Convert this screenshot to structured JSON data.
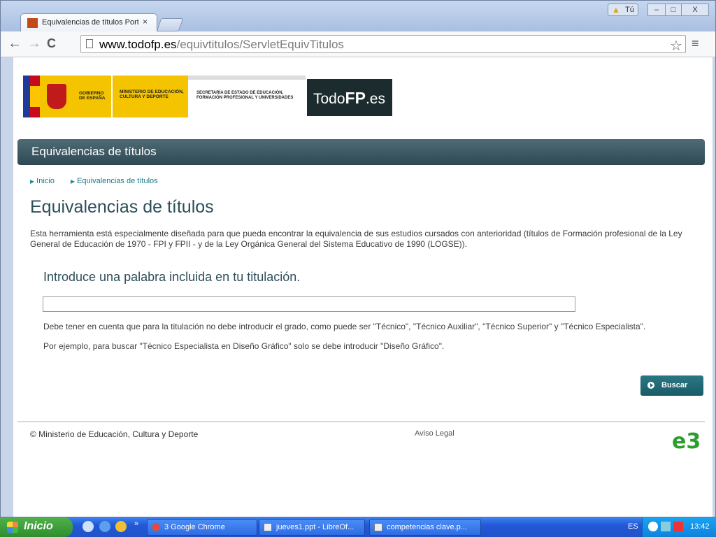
{
  "browser": {
    "tab_title": "Equivalencias de títulos Porta",
    "tab_close": "×",
    "warning_label": "Tú",
    "minimize": "–",
    "maximize": "□",
    "close": "X",
    "back": "←",
    "forward": "→",
    "reload": "C",
    "url_host": "www.todofp.es",
    "url_path": "/equivtitulos/ServletEquivTitulos",
    "bookmark": "☆",
    "menu": "≡"
  },
  "logos": {
    "gobierno": "GOBIERNO DE ESPAÑA",
    "ministerio": "MINISTERIO DE EDUCACIÓN, CULTURA Y DEPORTE",
    "secretaria": "SECRETARÍA DE ESTADO DE EDUCACIÓN, FORMACIÓN PROFESIONAL Y UNIVERSIDADES",
    "todofp_a": "Todo",
    "todofp_b": "FP",
    "todofp_c": ".es"
  },
  "banner": {
    "title": "Equivalencias de títulos"
  },
  "breadcrumb": [
    "Inicio",
    "Equivalencias de títulos"
  ],
  "main": {
    "title": "Equivalencias de títulos",
    "intro": "Esta herramienta está especialmente diseñada para que pueda encontrar la equivalencia de sus estudios cursados con anterioridad (títulos de Formación profesional de la Ley General de Educación de 1970 - FPI y FPII - y de la Ley Orgánica General del Sistema Educativo de 1990 (LOGSE)).",
    "search_heading": "Introduce una palabra incluida en tu titulación.",
    "search_value": "",
    "note1": "Debe tener en cuenta que para la titulación no debe introducir el grado, como puede ser \"Técnico\", \"Técnico Auxiliar\", \"Técnico Superior\" y \"Técnico Especialista\".",
    "note2": "Por ejemplo, para buscar \"Técnico Especialista en Diseño Gráfico\" solo se debe introducir \"Diseño Gráfico\".",
    "button": "Buscar"
  },
  "footer": {
    "copyright": "© Ministerio de Educación, Cultura y Deporte",
    "legal": "Aviso Legal",
    "logo": "e3"
  },
  "taskbar": {
    "start": "Inicio",
    "more": "»",
    "tasks": [
      "3 Google Chrome",
      "jueves1.ppt - LibreOf...",
      "competencias clave.p..."
    ],
    "lang": "ES",
    "clock": "13:42"
  }
}
